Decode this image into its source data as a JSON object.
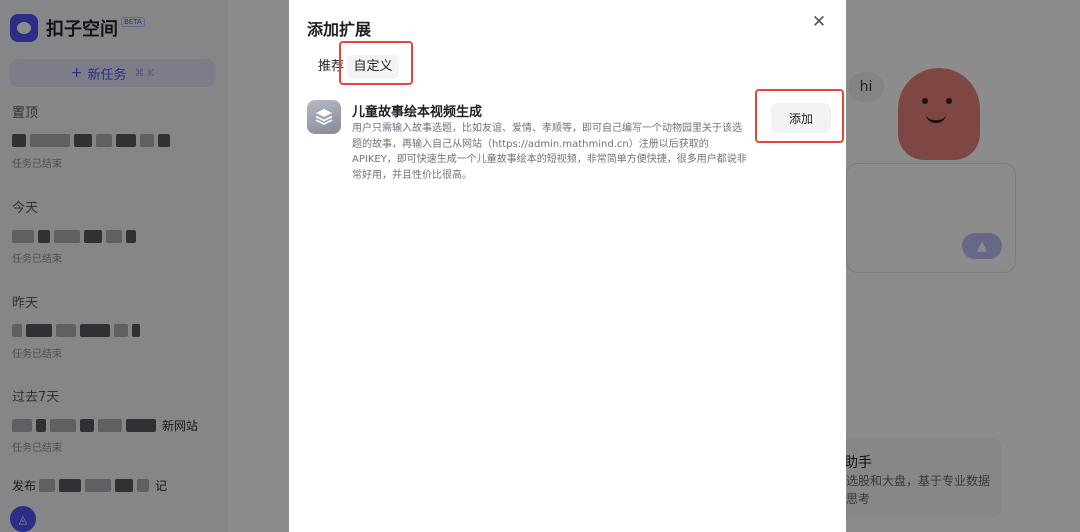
{
  "background_app": {
    "brand": {
      "name": "扣子空间",
      "badge": "BETA"
    },
    "new_task": {
      "label": "新任务",
      "plus_icon": "plus-icon",
      "shortcut": "⌘ K"
    },
    "groups": [
      {
        "label": "置顶",
        "task_suffix": "",
        "status": "任务已结束"
      },
      {
        "label": "今天",
        "task_suffix": "",
        "status": "任务已结束"
      },
      {
        "label": "昨天",
        "task_suffix": "",
        "status": "任务已结束"
      },
      {
        "label": "过去7天",
        "task_suffix": "新网站",
        "status": "任务已结束"
      },
      {
        "label": "",
        "task_prefix": "发布",
        "task_suffix": "记",
        "status": ""
      }
    ],
    "user_avatar_icon": "user-avatar-icon",
    "greeting_bubble": "hi",
    "assist_card": {
      "title": "助手",
      "desc": "选股和大盘，基于专业数据思考"
    }
  },
  "modal": {
    "title": "添加扩展",
    "close_icon": "close-icon",
    "tabs": [
      {
        "label": "推荐",
        "selected": false
      },
      {
        "label": "自定义",
        "selected": true
      }
    ],
    "extension": {
      "icon": "layers-icon",
      "name": "儿童故事绘本视频生成",
      "description": "用户只需输入故事选题，比如友谊、爱情、孝顺等，即可自己编写一个动物园里关于该选题的故事，再输入自己从网站（https://admin.mathmind.cn）注册以后获取的APIKEY，即可快速生成一个儿童故事绘本的短视频，非常简单方便快捷，很多用户都说非常好用，并且性价比很高。",
      "add_label": "添加"
    }
  },
  "colors": {
    "accent": "#4d55f5",
    "highlight": "#e8443a",
    "overlay": "rgba(0,0,0,0.45)"
  }
}
